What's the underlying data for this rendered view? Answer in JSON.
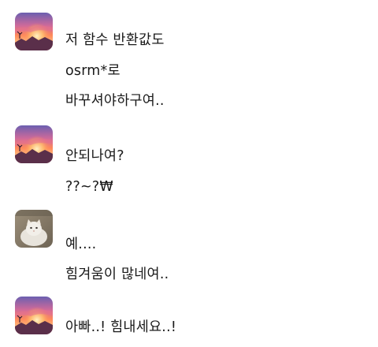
{
  "chat": {
    "messages": [
      {
        "avatar": "sunset-avatar-icon",
        "lines": [
          "저 함수 반환값도",
          "osrm*로",
          "바꾸셔야하구여.."
        ]
      },
      {
        "avatar": "sunset-avatar-icon",
        "lines": [
          "안되나여?",
          "??~?₩"
        ]
      },
      {
        "avatar": "cat-avatar-icon",
        "lines": [
          "예....",
          "힘겨움이 많네여.."
        ]
      },
      {
        "avatar": "sunset-avatar-icon",
        "lines": [
          "아빠..! 힘내세요..!"
        ]
      }
    ]
  },
  "colors": {
    "background": "#ffffff",
    "text": "#1a1a1a",
    "sunset_sky_top": "#6b5fb0",
    "sunset_glow": "#ff7a4a",
    "cat_bg": "#8a7e6c"
  }
}
